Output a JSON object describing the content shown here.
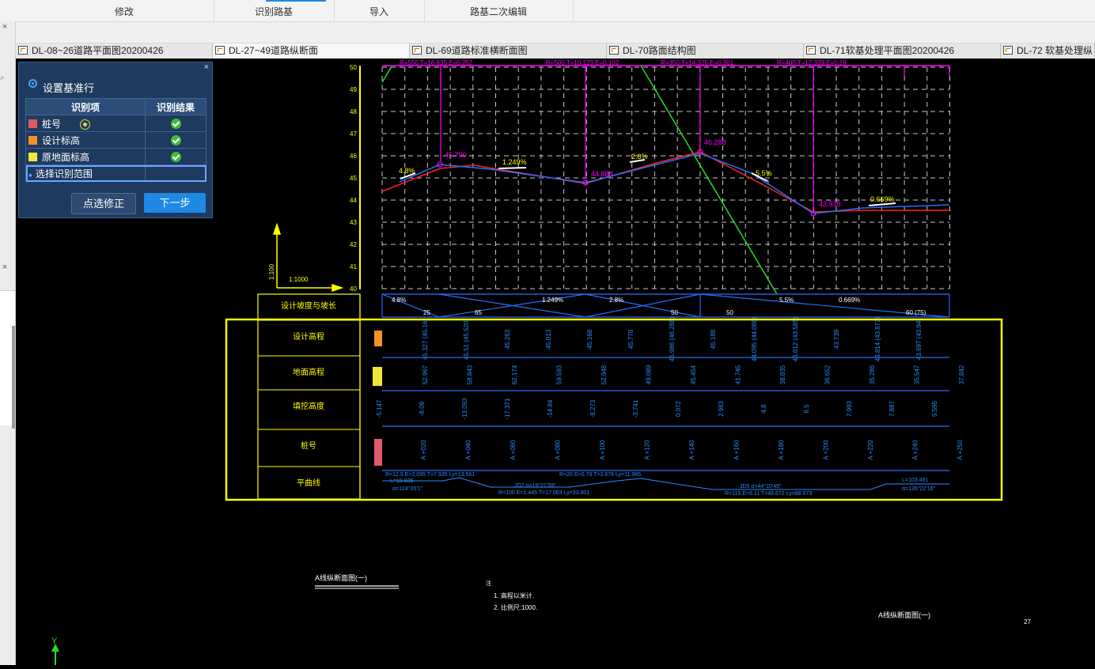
{
  "menubar": {
    "items": [
      "修改",
      "识别路基",
      "导入",
      "路基二次编辑"
    ]
  },
  "tabs": [
    "DL-08~26道路平面图20200426",
    "DL-27~49道路纵断面",
    "DL-69道路标准横断面图",
    "DL-70路面结构图",
    "DL-71软基处理平面图20200426",
    "DL-72 软基处理纵"
  ],
  "left_strip": {
    "close1": "×",
    "close2": "×"
  },
  "panel": {
    "close": "×",
    "title": "设置基准行",
    "icon": "gear-icon",
    "col_item": "识别项",
    "col_result": "识别结果",
    "rows": [
      {
        "label": "桩号",
        "color": "#e05a6a",
        "status": "ok"
      },
      {
        "label": "设计标高",
        "color": "#f5902a",
        "status": "ok"
      },
      {
        "label": "原地面标高",
        "color": "#f3e53a",
        "status": "ok"
      }
    ],
    "select_row": "选择识别范围",
    "btn_fix": "点选修正",
    "btn_next": "下一步"
  },
  "drawing": {
    "axis_y_labels": [
      "50",
      "49",
      "48",
      "47",
      "46",
      "45",
      "44",
      "43",
      "42",
      "41",
      "40"
    ],
    "scale_v": "1:100",
    "scale_h": "1:1000",
    "curve_labels": [
      "R=550 T=16.635 E=0.252",
      "R=500 T=10.123 E=0.102",
      "R=350 T=14.325 E=0.301",
      "R=400 T=12.339 E=0.19"
    ],
    "slope_labels": [
      "4.8%",
      "1.249%",
      "2.8%",
      "5.5%",
      "0.669%"
    ],
    "elev_marks": [
      "45.790",
      "44.888",
      "46.288",
      "43.938"
    ],
    "grade_row": [
      "4.8%",
      "1.249%",
      "2.8%",
      "5.5%",
      "0.669%"
    ],
    "length_row": [
      "25",
      "65",
      "50",
      "50",
      "60 (75)"
    ],
    "row_headers": [
      "设计坡度与坡长",
      "设计高程",
      "地面高程",
      "填挖高度",
      "桩号",
      "平曲线"
    ],
    "design_elev": [
      "45.327 (45.16)",
      "45.51 (45.520)",
      "45.263",
      "45.013",
      "45.168",
      "45.778",
      "45.986 (46.288)",
      "45.188",
      "44.095 (44.088)",
      "43.612 (43.585)",
      "43.739",
      "43.814 (43.873)",
      "43.697 (43.94)"
    ],
    "ground_elev": [
      "52.967",
      "58.843",
      "62.174",
      "59.593",
      "52.948",
      "49.089",
      "45.454",
      "41.745",
      "38.835",
      "36.652",
      "35.286",
      "35.547",
      "37.842"
    ],
    "fill_cut": [
      "-5.147",
      "-8.09",
      "-13.093",
      "-17.371",
      "-14.84",
      "-8.273",
      "-3.741",
      "0.072",
      "2.983",
      "4.8",
      "6.5",
      "7.993",
      "7.887",
      "5.595"
    ],
    "stations": [
      "A +020",
      "A +040",
      "A +060",
      "A +080",
      "A +100",
      "A +120",
      "A +140",
      "A +160",
      "A +180",
      "A +200",
      "A +220",
      "A +240",
      "A +250"
    ],
    "plan_curve_text": [
      "R=12.5 E=2.095 T=7.935 Ly=13.561",
      "L=19.925",
      "α=124°20'1\"",
      "JD2 α=19°21'59\"",
      "R=100 E=1.445 T=17.063 Ly=33.801",
      "R=20 E=0.79 T=3.678 Ly=11.965",
      "JD5 α=44°10'45\"",
      "R=115 E=9.11 T=46.672 Ly=88.673",
      "L=103.491",
      "α=135°22'16\""
    ],
    "footer_left": "A线纵断面图(一)",
    "notes_title": "注",
    "notes": [
      "1. 高程以米计.",
      "2. 比例尺:1000."
    ],
    "footer_right": "A线纵断面图(一)",
    "page_no": "27",
    "ucs_y": "Y"
  },
  "colors": {
    "accent": "#1e88e5",
    "panel_bg": "#1f3a5f",
    "cad_yellow": "#ffff00",
    "cad_blue": "#2b6cff",
    "cad_magenta": "#ff00ff",
    "cad_red": "#ff2020",
    "cad_green": "#20e020"
  }
}
